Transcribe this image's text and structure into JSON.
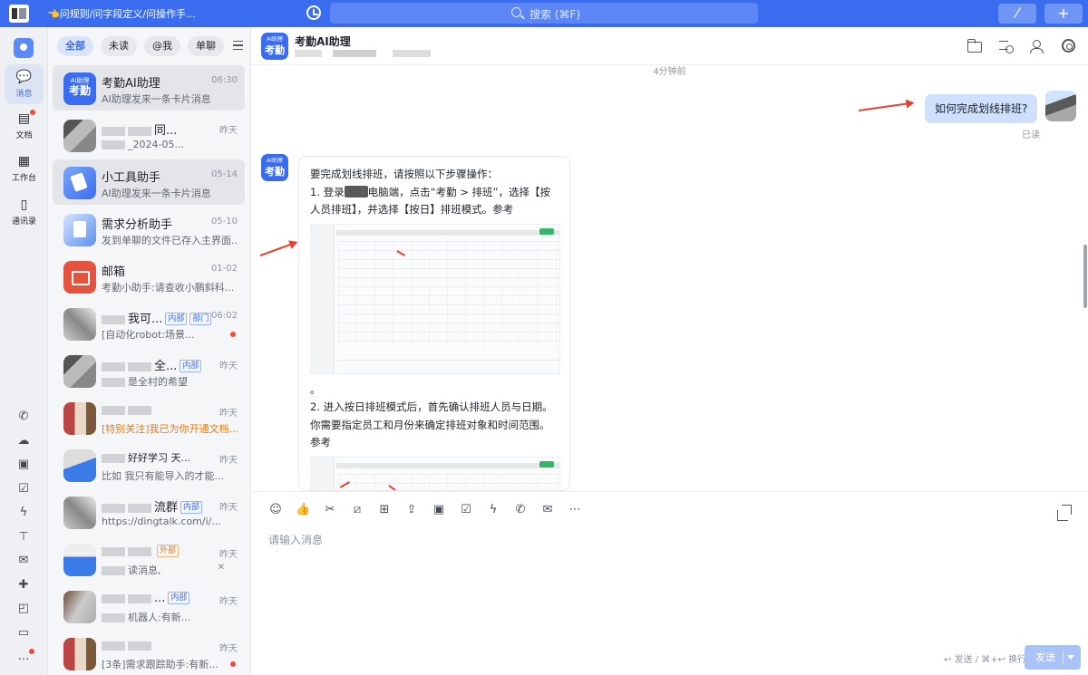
{
  "topbar": {
    "prompt": "👈问规则/问字段定义/问操作手...",
    "search_placeholder": "搜索 (⌘F)",
    "slash_label": "⁄",
    "plus_label": "+"
  },
  "nav": {
    "items": [
      {
        "label": "消息",
        "icon": "message-icon"
      },
      {
        "label": "文档",
        "icon": "document-icon"
      },
      {
        "label": "工作台",
        "icon": "workbench-icon"
      },
      {
        "label": "通讯录",
        "icon": "contacts-icon"
      }
    ]
  },
  "filters": [
    "全部",
    "未读",
    "@我",
    "单聊"
  ],
  "conversations": [
    {
      "name": "考勤AI助理",
      "time": "06:30",
      "preview": "AI助理发来一条卡片消息"
    },
    {
      "name": "同...",
      "time": "昨天",
      "preview": "_2024-05..."
    },
    {
      "name": "小工具助手",
      "time": "05-14",
      "preview": "AI助理发来一条卡片消息"
    },
    {
      "name": "需求分析助手",
      "time": "05-10",
      "preview": "发到单聊的文件已存入主界面..."
    },
    {
      "name": "邮箱",
      "time": "01-02",
      "preview": "考勤小助手:请查收小鹏斜科..."
    },
    {
      "name": "我可...",
      "time": "06:02",
      "tags": [
        "内部",
        "部门"
      ],
      "preview": "[自动化robot:场景..."
    },
    {
      "name": "全...",
      "time": "昨天",
      "tags": [
        "内部"
      ],
      "preview": "是全村的希望"
    },
    {
      "name": "",
      "time": "昨天",
      "preview": "[特别关注]我已为你开通文档..."
    },
    {
      "name": "好好学习 天...",
      "time": "昨天",
      "preview": "比如 我只有能导入的才能..."
    },
    {
      "name": "流群",
      "time": "昨天",
      "tags": [
        "内部"
      ],
      "preview": "https://dingtalk.com/i/..."
    },
    {
      "name": "",
      "time": "昨天",
      "tags": [
        "外部"
      ],
      "preview": "读消息,"
    },
    {
      "name": "...",
      "time": "昨天",
      "tags": [
        "内部"
      ],
      "preview": "机器人:有新..."
    },
    {
      "name": "",
      "time": "昨天",
      "preview": "[3条]需求跟踪助手:有新..."
    }
  ],
  "chat": {
    "title": "考勤AI助理",
    "avatar_top": "AI助理",
    "avatar_bottom": "考勤",
    "timestamp": "4分钟前",
    "user_message": "如何完成划线排班?",
    "read_status": "已读",
    "bot_message": {
      "line1": "要完成划线排班，请按照以下步骤操作：",
      "step1_a": "1. 登录",
      "step1_b": "电脑端，点击“考勤 > 排班”，选择【按人员排班】，并选择【按日】排班模式。参考",
      "period": "。",
      "step2": "2. 进入按日排班模式后，首先确认排班人员与日期。你需要指定员工和月份来确定排班对象和时间范围。参考"
    }
  },
  "composer": {
    "placeholder": "请输入消息",
    "send_hint": "↩ 发送 / ⌘+↩ 换行",
    "send_label": "发送"
  },
  "colors": {
    "brand": "#3a6cf0",
    "bubble_me": "#cfe0fd",
    "annotation_arrow": "#e8402f"
  }
}
